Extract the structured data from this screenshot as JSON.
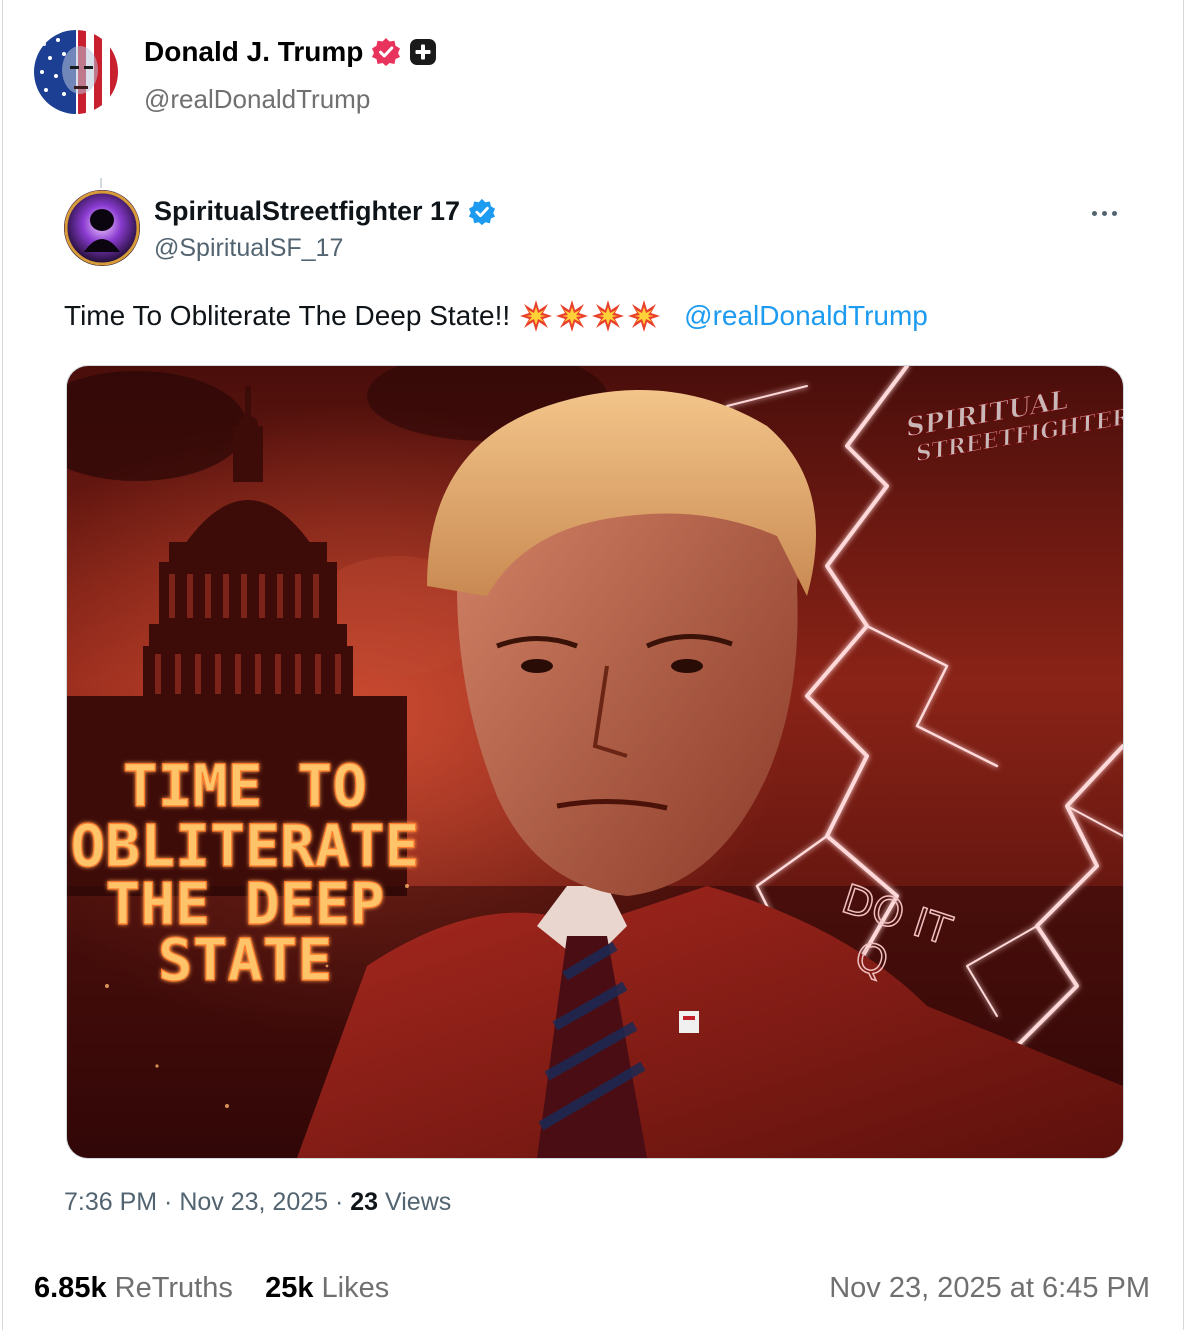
{
  "post": {
    "author": {
      "name": "Donald J. Trump",
      "handle": "@realDonaldTrump"
    },
    "retruths_count": "6.85k",
    "retruths_label": "ReTruths",
    "likes_count": "25k",
    "likes_label": "Likes",
    "timestamp": "Nov 23, 2025 at 6:45 PM"
  },
  "quoted": {
    "author": {
      "name": "SpiritualStreetfighter 17",
      "handle": "@SpiritualSF_17"
    },
    "text": "Time To Obliterate The Deep State!!",
    "emoji": [
      "💥",
      "💥",
      "💥",
      "💥"
    ],
    "mention": "@realDonaldTrump",
    "time_date": "7:36 PM · Nov 23, 2025 · ",
    "views_count": "23",
    "views_label": " Views",
    "image": {
      "headline_lines": [
        "TIME TO",
        "OBLITERATE",
        "THE DEEP",
        "STATE"
      ],
      "signature_lines": [
        "SPIRITUAL",
        "STREETFIGHTER"
      ],
      "suit_text_lines": [
        "DO IT",
        "Q"
      ]
    }
  },
  "colors": {
    "verified_pink": "#e8335d",
    "verified_blue": "#1d9bf0",
    "link": "#1d9bf0",
    "muted": "#536471",
    "image_red": "#8a1a14"
  },
  "icons": [
    "verified-badge-icon",
    "plus-icon",
    "more-options-icon",
    "collision-emoji-icon"
  ]
}
